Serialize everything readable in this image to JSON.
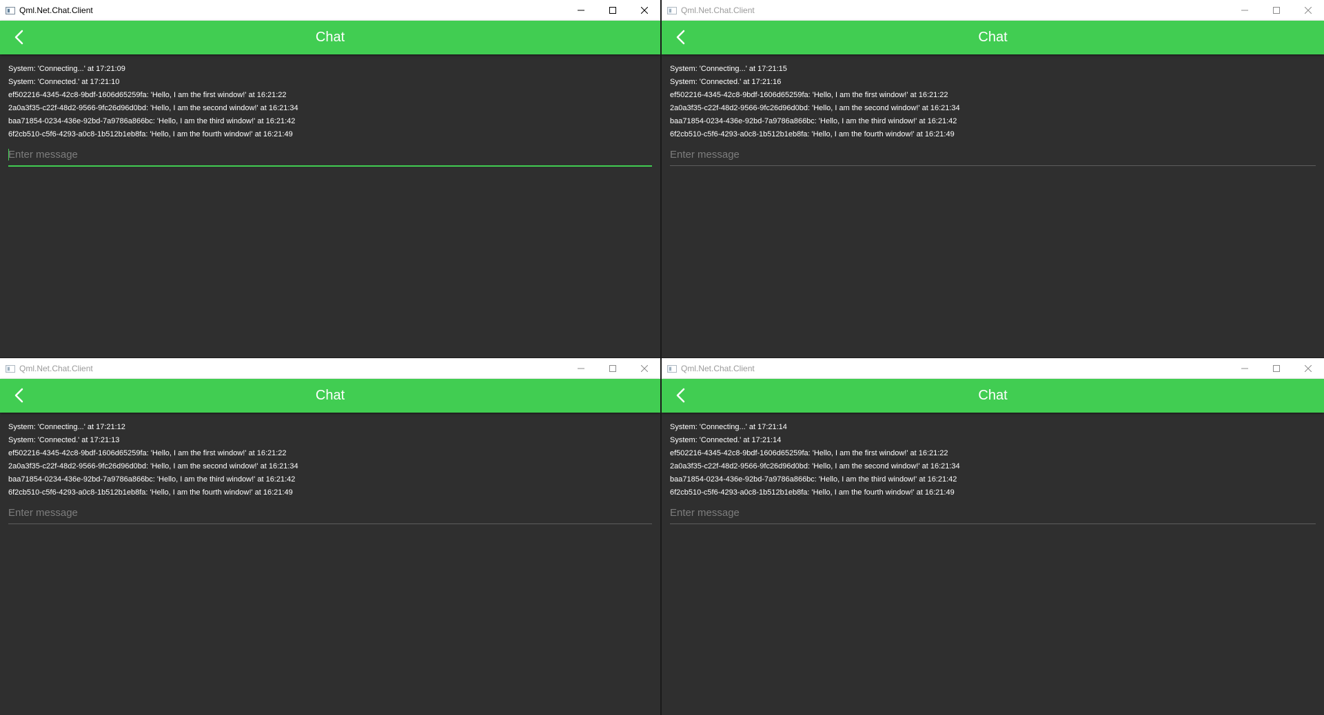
{
  "windows": [
    {
      "title": "Qml.Net.Chat.Client",
      "active": true,
      "header_title": "Chat",
      "messages": [
        "System: 'Connecting...' at 17:21:09",
        "System: 'Connected.' at 17:21:10",
        "ef502216-4345-42c8-9bdf-1606d65259fa: 'Hello, I am the first window!' at 16:21:22",
        "2a0a3f35-c22f-48d2-9566-9fc26d96d0bd: 'Hello, I am the second window!' at 16:21:34",
        "baa71854-0234-436e-92bd-7a9786a866bc: 'Hello, I am the third window!' at 16:21:42",
        "6f2cb510-c5f6-4293-a0c8-1b512b1eb8fa: 'Hello, I am the fourth window!' at 16:21:49"
      ],
      "input_placeholder": "Enter message",
      "input_value": ""
    },
    {
      "title": "Qml.Net.Chat.Client",
      "active": false,
      "header_title": "Chat",
      "messages": [
        "System: 'Connecting...' at 17:21:15",
        "System: 'Connected.' at 17:21:16",
        "ef502216-4345-42c8-9bdf-1606d65259fa: 'Hello, I am the first window!' at 16:21:22",
        "2a0a3f35-c22f-48d2-9566-9fc26d96d0bd: 'Hello, I am the second window!' at 16:21:34",
        "baa71854-0234-436e-92bd-7a9786a866bc: 'Hello, I am the third window!' at 16:21:42",
        "6f2cb510-c5f6-4293-a0c8-1b512b1eb8fa: 'Hello, I am the fourth window!' at 16:21:49"
      ],
      "input_placeholder": "Enter message",
      "input_value": ""
    },
    {
      "title": "Qml.Net.Chat.Client",
      "active": false,
      "header_title": "Chat",
      "messages": [
        "System: 'Connecting...' at 17:21:12",
        "System: 'Connected.' at 17:21:13",
        "ef502216-4345-42c8-9bdf-1606d65259fa: 'Hello, I am the first window!' at 16:21:22",
        "2a0a3f35-c22f-48d2-9566-9fc26d96d0bd: 'Hello, I am the second window!' at 16:21:34",
        "baa71854-0234-436e-92bd-7a9786a866bc: 'Hello, I am the third window!' at 16:21:42",
        "6f2cb510-c5f6-4293-a0c8-1b512b1eb8fa: 'Hello, I am the fourth window!' at 16:21:49"
      ],
      "input_placeholder": "Enter message",
      "input_value": ""
    },
    {
      "title": "Qml.Net.Chat.Client",
      "active": false,
      "header_title": "Chat",
      "messages": [
        "System: 'Connecting...' at 17:21:14",
        "System: 'Connected.' at 17:21:14",
        "ef502216-4345-42c8-9bdf-1606d65259fa: 'Hello, I am the first window!' at 16:21:22",
        "2a0a3f35-c22f-48d2-9566-9fc26d96d0bd: 'Hello, I am the second window!' at 16:21:34",
        "baa71854-0234-436e-92bd-7a9786a866bc: 'Hello, I am the third window!' at 16:21:42",
        "6f2cb510-c5f6-4293-a0c8-1b512b1eb8fa: 'Hello, I am the fourth window!' at 16:21:49"
      ],
      "input_placeholder": "Enter message",
      "input_value": ""
    }
  ],
  "colors": {
    "accent": "#41cd52",
    "background": "#2f2f2f",
    "titlebar": "#ffffff",
    "text": "#ffffff",
    "placeholder": "#7d7d7d"
  },
  "icons": {
    "app": "app-window-icon",
    "back": "chevron-left-icon",
    "minimize": "minimize-icon",
    "maximize": "maximize-icon",
    "close": "close-icon"
  }
}
